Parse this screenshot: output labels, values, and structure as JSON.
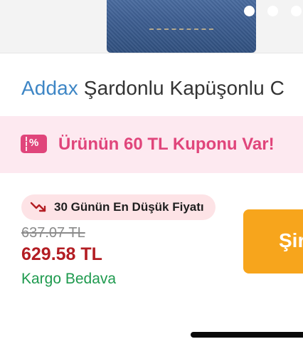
{
  "gallery": {
    "dot_count": 3
  },
  "product": {
    "brand": "Addax",
    "name": "Şardonlu Kapüşonlu C"
  },
  "coupon": {
    "text": "Ürünün 60 TL Kuponu Var!",
    "icon": "coupon-ticket-icon",
    "icon_glyph": "%",
    "color": "#e0457b",
    "background": "#fde9f0"
  },
  "pricing": {
    "lowest_badge": "30 Günün En Düşük Fiyatı",
    "lowest_icon": "trend-down-icon",
    "old_price": "637.07 TL",
    "new_price": "629.58 TL",
    "shipping": "Kargo Bedava",
    "price_color": "#b31d23",
    "shipping_color": "#1e9a4e"
  },
  "cta": {
    "label": "Şir",
    "color": "#f7a51c"
  }
}
